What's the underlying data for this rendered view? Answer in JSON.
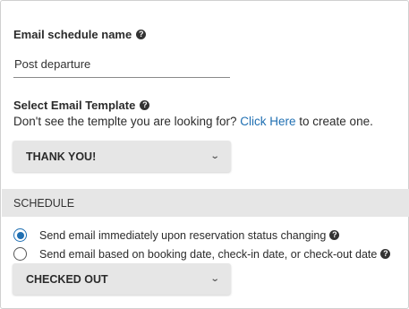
{
  "schedule_name": {
    "label": "Email schedule name",
    "value": "Post departure"
  },
  "template": {
    "label": "Select Email Template",
    "hint_prefix": "Don't see the templte you are looking for?",
    "hint_link": "Click Here",
    "hint_suffix": "to create one.",
    "selected": "THANK YOU!"
  },
  "schedule": {
    "header": "SCHEDULE",
    "options": [
      {
        "label": "Send email immediately upon reservation status changing",
        "checked": true
      },
      {
        "label": "Send email based on booking date, check-in date, or check-out date",
        "checked": false
      }
    ],
    "status_selected": "CHECKED OUT"
  },
  "icons": {
    "help": "question-circle-icon",
    "chevron": "chevron-down-icon"
  },
  "colors": {
    "accent": "#1f6fb2",
    "dropdown_bg": "#e6e6e6",
    "header_bg": "#e6e6e6"
  }
}
